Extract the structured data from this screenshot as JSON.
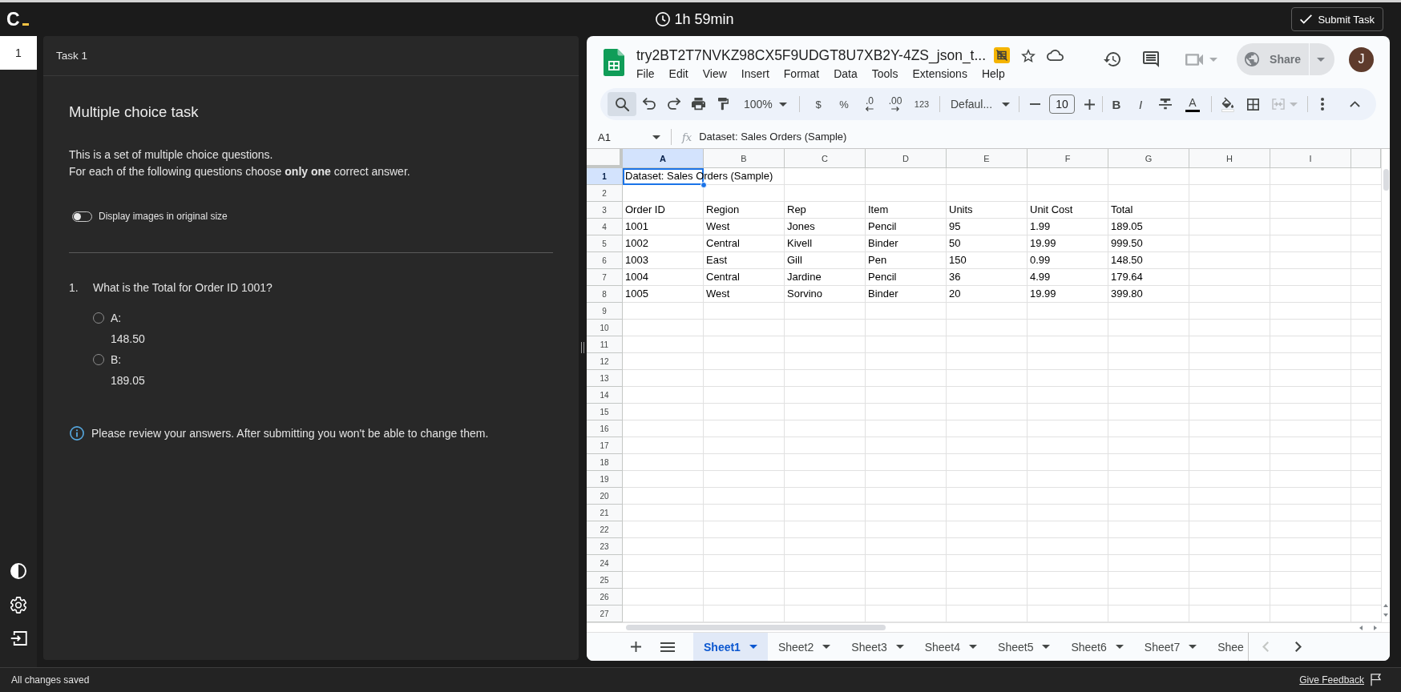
{
  "topbar": {
    "logo": "C",
    "timer": "1h 59min",
    "submit_button": "Submit Task"
  },
  "task_nav": [
    {
      "label": "1",
      "selected": true
    }
  ],
  "task_panel": {
    "header": "Task 1",
    "title": "Multiple choice task",
    "intro": [
      "This is a set of multiple choice questions.",
      "For each of the following questions choose **only one** correct answer."
    ],
    "toggle": {
      "label": "Display images in original size",
      "on": false
    },
    "questions": [
      {
        "number": "1.",
        "text": "What is the Total for Order ID 1001?",
        "options": [
          {
            "label": "A:",
            "value": "148.50",
            "selected": false
          },
          {
            "label": "B:",
            "value": "189.05",
            "selected": false
          }
        ]
      }
    ],
    "notice": "Please review your answers. After submitting you won't be able to change them."
  },
  "spreadsheet": {
    "title": "try2BT2T7NVKZ98CX5F9UDGT8U7XB2Y-4ZS_json_t...",
    "menu": [
      "File",
      "Edit",
      "View",
      "Insert",
      "Format",
      "Data",
      "Tools",
      "Extensions",
      "Help"
    ],
    "share_button": "Share",
    "avatar": "J",
    "toolbar": {
      "search": {
        "active": true
      },
      "zoom": "100%",
      "currency": "$",
      "percent": "%",
      "decrease_decimals": ".0",
      "increase_decimals": ".00",
      "number_format": "123",
      "font": "Defaul...",
      "font_size": "10",
      "bold": "B",
      "italic": "I",
      "text_color": "A",
      "merge_cells": {
        "disabled": true
      }
    },
    "formula_bar": {
      "cell_reference": "A1",
      "function_label": "fx",
      "content": "Dataset: Sales Orders (Sample)"
    },
    "columns": [
      {
        "label": "A",
        "selected": true
      },
      {
        "label": "B",
        "selected": false
      },
      {
        "label": "C",
        "selected": false
      },
      {
        "label": "D",
        "selected": false
      },
      {
        "label": "E",
        "selected": false
      },
      {
        "label": "F",
        "selected": false
      },
      {
        "label": "G",
        "selected": false
      },
      {
        "label": "H",
        "selected": false
      },
      {
        "label": "I",
        "selected": false
      }
    ],
    "rows": [
      {
        "number": "1",
        "selected": true,
        "cells": [
          "Dataset: Sales Orders (Sample)"
        ]
      },
      {
        "number": "2",
        "selected": false
      },
      {
        "number": "3",
        "selected": false,
        "cells": [
          "Order ID",
          "Region",
          "Rep",
          "Item",
          "Units",
          "Unit Cost",
          "Total"
        ]
      },
      {
        "number": "4",
        "selected": false,
        "cells": [
          "1001",
          "West",
          "Jones",
          "Pencil",
          "95",
          "1.99",
          "189.05"
        ]
      },
      {
        "number": "5",
        "selected": false,
        "cells": [
          "1002",
          "Central",
          "Kivell",
          "Binder",
          "50",
          "19.99",
          "999.50"
        ]
      },
      {
        "number": "6",
        "selected": false,
        "cells": [
          "1003",
          "East",
          "Gill",
          "Pen",
          "150",
          "0.99",
          "148.50"
        ]
      },
      {
        "number": "7",
        "selected": false,
        "cells": [
          "1004",
          "Central",
          "Jardine",
          "Pencil",
          "36",
          "4.99",
          "179.64"
        ]
      },
      {
        "number": "8",
        "selected": false,
        "cells": [
          "1005",
          "West",
          "Sorvino",
          "Binder",
          "20",
          "19.99",
          "399.80"
        ]
      },
      {
        "number": "9",
        "selected": false
      },
      {
        "number": "10",
        "selected": false
      },
      {
        "number": "11",
        "selected": false
      },
      {
        "number": "12",
        "selected": false
      },
      {
        "number": "13",
        "selected": false
      },
      {
        "number": "14",
        "selected": false
      },
      {
        "number": "15",
        "selected": false
      },
      {
        "number": "16",
        "selected": false
      },
      {
        "number": "17",
        "selected": false
      },
      {
        "number": "18",
        "selected": false
      },
      {
        "number": "19",
        "selected": false
      },
      {
        "number": "20",
        "selected": false
      },
      {
        "number": "21",
        "selected": false
      },
      {
        "number": "22",
        "selected": false
      },
      {
        "number": "23",
        "selected": false
      },
      {
        "number": "24",
        "selected": false
      },
      {
        "number": "25",
        "selected": false
      },
      {
        "number": "26",
        "selected": false
      },
      {
        "number": "27",
        "selected": false
      }
    ],
    "sheets": [
      {
        "name": "Sheet1",
        "selected": true
      },
      {
        "name": "Sheet2",
        "selected": false
      },
      {
        "name": "Sheet3",
        "selected": false
      },
      {
        "name": "Sheet4",
        "selected": false
      },
      {
        "name": "Sheet5",
        "selected": false
      },
      {
        "name": "Sheet6",
        "selected": false
      },
      {
        "name": "Sheet7",
        "selected": false
      },
      {
        "name": "Shee",
        "selected": false
      }
    ],
    "sheet_scroll": [
      {
        "kind": "previous",
        "disabled": true
      },
      {
        "kind": "next",
        "disabled": false
      }
    ]
  },
  "status_bar": {
    "status": "All changes saved",
    "feedback_link": "Give Feedback"
  }
}
